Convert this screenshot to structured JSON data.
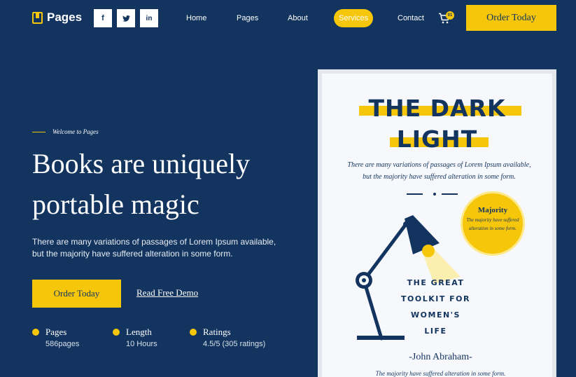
{
  "nav": {
    "logo_text": "Pages",
    "social": [
      {
        "icon": "facebook-icon",
        "glyph": "f"
      },
      {
        "icon": "twitter-icon",
        "glyph": "t"
      },
      {
        "icon": "linkedin-icon",
        "glyph": "in"
      }
    ],
    "menu": [
      "Home",
      "Pages",
      "About",
      "Services",
      "Contact"
    ],
    "active_menu": "Services",
    "cart_count": "01",
    "order_label": "Order Today"
  },
  "hero": {
    "welcome": "Welcome to Pages",
    "headline_line1": "Books are uniquely",
    "headline_line2": "portable magic",
    "description": "There are many variations of passages of Lorem Ipsum available, but the majority have suffered alteration in some form.",
    "order_label": "Order Today",
    "demo_label": "Read Free Demo",
    "stats": [
      {
        "label": "Pages",
        "value": "586pages"
      },
      {
        "label": "Length",
        "value": "10 Hours"
      },
      {
        "label": "Ratings",
        "value": "4.5/5 (305 ratings)"
      }
    ]
  },
  "book": {
    "title_line1": "THE DARK",
    "title_line2": "LIGHT",
    "description": "There are many variations of passages of Lorem Ipsum available, but the majority have suffered alteration in some form.",
    "badge_title": "Majority",
    "badge_text": "The majority have suffered alteration in some form.",
    "toolkit_line1": "THE GREAT",
    "toolkit_line2": "TOOLKIT FOR",
    "toolkit_line3": "WOMEN'S",
    "toolkit_line4": "LIFE",
    "author": "-John Abraham-",
    "footer_text": "The majority have suffered alteration in some form."
  },
  "colors": {
    "background": "#12345f",
    "accent": "#f6c60a",
    "book_page": "#f6f8fc"
  }
}
